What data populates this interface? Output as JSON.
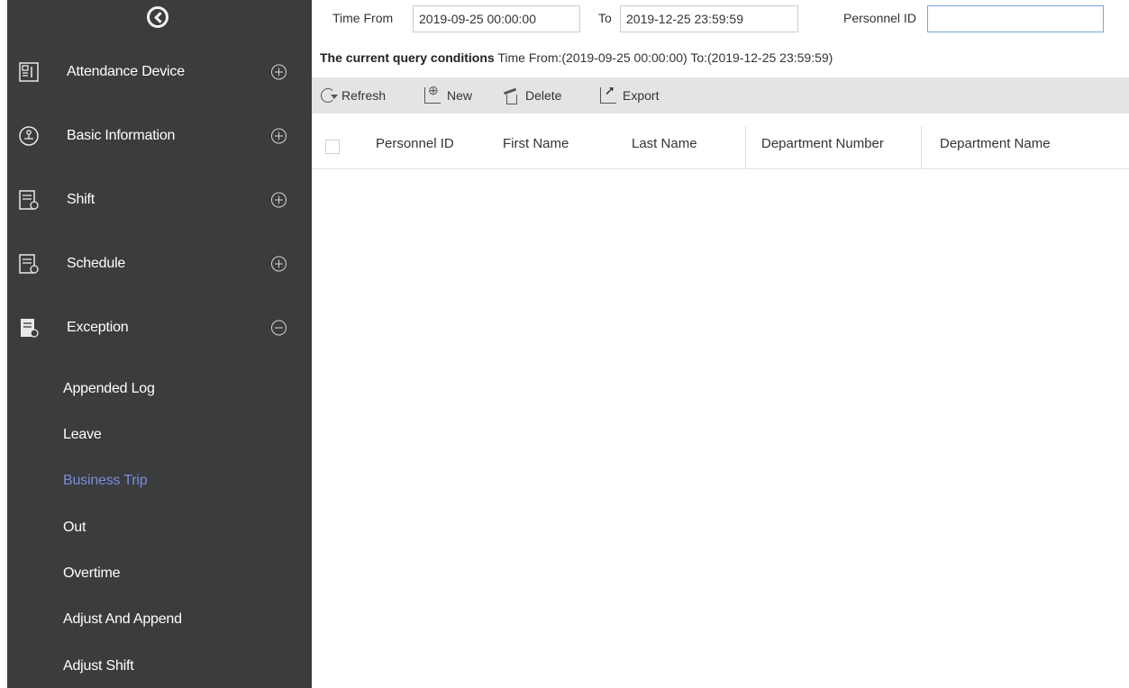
{
  "sidebar": {
    "menu": [
      {
        "label": "Attendance Device",
        "toggle": "plus"
      },
      {
        "label": "Basic Information",
        "toggle": "plus"
      },
      {
        "label": "Shift",
        "toggle": "plus"
      },
      {
        "label": "Schedule",
        "toggle": "plus"
      },
      {
        "label": "Exception",
        "toggle": "minus"
      }
    ],
    "sub_items": [
      {
        "label": "Appended Log"
      },
      {
        "label": "Leave"
      },
      {
        "label": "Business Trip",
        "active": true
      },
      {
        "label": "Out"
      },
      {
        "label": "Overtime"
      },
      {
        "label": "Adjust And Append"
      },
      {
        "label": "Adjust Shift"
      }
    ]
  },
  "filter": {
    "time_from_label": "Time From",
    "time_from_value": "2019-09-25 00:00:00",
    "to_label": "To",
    "to_value": "2019-12-25 23:59:59",
    "personnel_id_label": "Personnel ID",
    "personnel_id_value": ""
  },
  "query": {
    "prefix": "The current query conditions",
    "text": "Time From:(2019-09-25 00:00:00)  To:(2019-12-25 23:59:59)"
  },
  "toolbar": {
    "refresh": "Refresh",
    "new": "New",
    "delete": "Delete",
    "export": "Export"
  },
  "table": {
    "columns": [
      "Personnel ID",
      "First Name",
      "Last Name",
      "Department Number",
      "Department Name"
    ],
    "rows": []
  },
  "colors": {
    "sidebar_bg": "#3a3c3e",
    "active_item": "#7c8cd8",
    "toolbar_bg": "#e4e4e4"
  }
}
